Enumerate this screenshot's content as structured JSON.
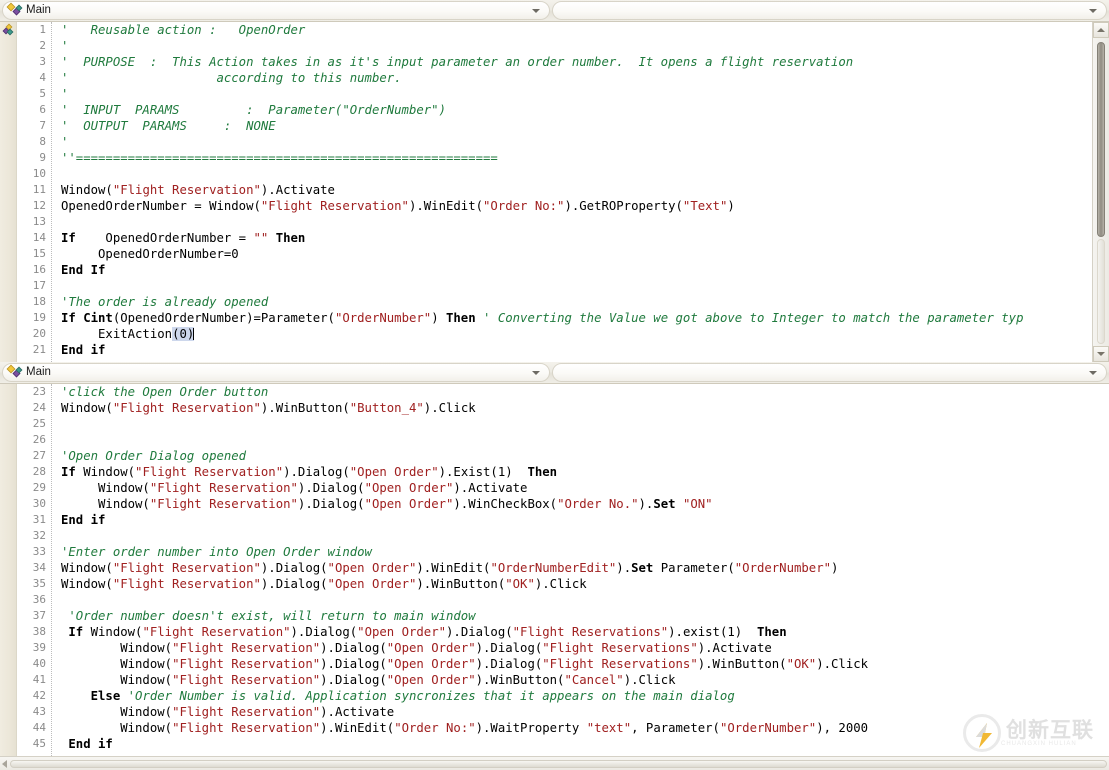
{
  "window": {
    "title": "Main",
    "app_kind": "script-editor"
  },
  "panes": [
    {
      "header": {
        "icon": "flow-action-icon",
        "label": "Main",
        "dropdown_icon": "chevron-down-icon",
        "second_combo_value": "",
        "second_dropdown_icon": "chevron-down-icon"
      },
      "gutter_icon": "flow-action-icon",
      "first_line": 1,
      "lines": [
        {
          "n": 1,
          "tokens": [
            {
              "t": "cm",
              "v": "'   Reusable action :   OpenOrder"
            }
          ]
        },
        {
          "n": 2,
          "tokens": [
            {
              "t": "cm",
              "v": "'"
            }
          ]
        },
        {
          "n": 3,
          "tokens": [
            {
              "t": "cm",
              "v": "'  PURPOSE  :  This Action takes in as it's input parameter an order number.  It opens a flight reservation"
            }
          ]
        },
        {
          "n": 4,
          "tokens": [
            {
              "t": "cm",
              "v": "'                    according to this number."
            }
          ]
        },
        {
          "n": 5,
          "tokens": [
            {
              "t": "cm",
              "v": "'"
            }
          ]
        },
        {
          "n": 6,
          "tokens": [
            {
              "t": "cm",
              "v": "'  INPUT  PARAMS         :  Parameter(\"OrderNumber\")"
            }
          ]
        },
        {
          "n": 7,
          "tokens": [
            {
              "t": "cm",
              "v": "'  OUTPUT  PARAMS     :  NONE"
            }
          ]
        },
        {
          "n": 8,
          "tokens": [
            {
              "t": "cm",
              "v": "'"
            }
          ]
        },
        {
          "n": 9,
          "tokens": [
            {
              "t": "cm",
              "v": "''========================================================="
            }
          ]
        },
        {
          "n": 10,
          "tokens": []
        },
        {
          "n": 11,
          "tokens": [
            {
              "t": "pl",
              "v": "Window("
            },
            {
              "t": "str",
              "v": "\"Flight Reservation\""
            },
            {
              "t": "pl",
              "v": ").Activate"
            }
          ]
        },
        {
          "n": 12,
          "tokens": [
            {
              "t": "pl",
              "v": "OpenedOrderNumber = Window("
            },
            {
              "t": "str",
              "v": "\"Flight Reservation\""
            },
            {
              "t": "pl",
              "v": ").WinEdit("
            },
            {
              "t": "str",
              "v": "\"Order No:\""
            },
            {
              "t": "pl",
              "v": ").GetROProperty("
            },
            {
              "t": "str",
              "v": "\"Text\""
            },
            {
              "t": "pl",
              "v": ")"
            }
          ]
        },
        {
          "n": 13,
          "tokens": []
        },
        {
          "n": 14,
          "tokens": [
            {
              "t": "kw",
              "v": "If"
            },
            {
              "t": "pl",
              "v": "    OpenedOrderNumber = "
            },
            {
              "t": "str",
              "v": "\"\""
            },
            {
              "t": "pl",
              "v": " "
            },
            {
              "t": "kw",
              "v": "Then"
            }
          ]
        },
        {
          "n": 15,
          "tokens": [
            {
              "t": "pl",
              "v": "     OpenedOrderNumber=0"
            }
          ]
        },
        {
          "n": 16,
          "tokens": [
            {
              "t": "kw",
              "v": "End If"
            }
          ]
        },
        {
          "n": 17,
          "tokens": []
        },
        {
          "n": 18,
          "tokens": [
            {
              "t": "cm",
              "v": "'The order is already opened"
            }
          ]
        },
        {
          "n": 19,
          "tokens": [
            {
              "t": "kw",
              "v": "If Cint"
            },
            {
              "t": "pl",
              "v": "(OpenedOrderNumber)=Parameter("
            },
            {
              "t": "str",
              "v": "\"OrderNumber\""
            },
            {
              "t": "pl",
              "v": ") "
            },
            {
              "t": "kw",
              "v": "Then"
            },
            {
              "t": "pl",
              "v": " "
            },
            {
              "t": "cm",
              "v": "' Converting the Value we got above to Integer to match the parameter typ"
            }
          ]
        },
        {
          "n": 20,
          "tokens": [
            {
              "t": "pl",
              "v": "     ExitAction"
            },
            {
              "t": "sel",
              "v": "(0)"
            },
            {
              "t": "caret",
              "v": ""
            }
          ]
        },
        {
          "n": 21,
          "tokens": [
            {
              "t": "kw",
              "v": "End if"
            }
          ]
        }
      ]
    },
    {
      "header": {
        "icon": "flow-action-icon",
        "label": "Main",
        "dropdown_icon": "chevron-down-icon",
        "second_combo_value": "",
        "second_dropdown_icon": "chevron-down-icon"
      },
      "gutter_icon": "flow-action-icon",
      "first_line": 23,
      "lines": [
        {
          "n": 23,
          "tokens": [
            {
              "t": "cm",
              "v": "'click the Open Order button"
            }
          ]
        },
        {
          "n": 24,
          "tokens": [
            {
              "t": "pl",
              "v": "Window("
            },
            {
              "t": "str",
              "v": "\"Flight Reservation\""
            },
            {
              "t": "pl",
              "v": ").WinButton("
            },
            {
              "t": "str",
              "v": "\"Button_4\""
            },
            {
              "t": "pl",
              "v": ").Click"
            }
          ]
        },
        {
          "n": 25,
          "tokens": []
        },
        {
          "n": 26,
          "tokens": []
        },
        {
          "n": 27,
          "tokens": [
            {
              "t": "cm",
              "v": "'Open Order Dialog opened"
            }
          ]
        },
        {
          "n": 28,
          "tokens": [
            {
              "t": "kw",
              "v": "If"
            },
            {
              "t": "pl",
              "v": " Window("
            },
            {
              "t": "str",
              "v": "\"Flight Reservation\""
            },
            {
              "t": "pl",
              "v": ").Dialog("
            },
            {
              "t": "str",
              "v": "\"Open Order\""
            },
            {
              "t": "pl",
              "v": ").Exist(1)  "
            },
            {
              "t": "kw",
              "v": "Then"
            }
          ]
        },
        {
          "n": 29,
          "tokens": [
            {
              "t": "pl",
              "v": "     Window("
            },
            {
              "t": "str",
              "v": "\"Flight Reservation\""
            },
            {
              "t": "pl",
              "v": ").Dialog("
            },
            {
              "t": "str",
              "v": "\"Open Order\""
            },
            {
              "t": "pl",
              "v": ").Activate"
            }
          ]
        },
        {
          "n": 30,
          "tokens": [
            {
              "t": "pl",
              "v": "     Window("
            },
            {
              "t": "str",
              "v": "\"Flight Reservation\""
            },
            {
              "t": "pl",
              "v": ").Dialog("
            },
            {
              "t": "str",
              "v": "\"Open Order\""
            },
            {
              "t": "pl",
              "v": ").WinCheckBox("
            },
            {
              "t": "str",
              "v": "\"Order No.\""
            },
            {
              "t": "pl",
              "v": ")."
            },
            {
              "t": "kw",
              "v": "Set"
            },
            {
              "t": "pl",
              "v": " "
            },
            {
              "t": "str",
              "v": "\"ON\""
            }
          ]
        },
        {
          "n": 31,
          "tokens": [
            {
              "t": "kw",
              "v": "End if"
            }
          ]
        },
        {
          "n": 32,
          "tokens": []
        },
        {
          "n": 33,
          "tokens": [
            {
              "t": "cm",
              "v": "'Enter order number into Open Order window"
            }
          ]
        },
        {
          "n": 34,
          "tokens": [
            {
              "t": "pl",
              "v": "Window("
            },
            {
              "t": "str",
              "v": "\"Flight Reservation\""
            },
            {
              "t": "pl",
              "v": ").Dialog("
            },
            {
              "t": "str",
              "v": "\"Open Order\""
            },
            {
              "t": "pl",
              "v": ").WinEdit("
            },
            {
              "t": "str",
              "v": "\"OrderNumberEdit\""
            },
            {
              "t": "pl",
              "v": ")."
            },
            {
              "t": "kw",
              "v": "Set"
            },
            {
              "t": "pl",
              "v": " Parameter("
            },
            {
              "t": "str",
              "v": "\"OrderNumber\""
            },
            {
              "t": "pl",
              "v": ")"
            }
          ]
        },
        {
          "n": 35,
          "tokens": [
            {
              "t": "pl",
              "v": "Window("
            },
            {
              "t": "str",
              "v": "\"Flight Reservation\""
            },
            {
              "t": "pl",
              "v": ").Dialog("
            },
            {
              "t": "str",
              "v": "\"Open Order\""
            },
            {
              "t": "pl",
              "v": ").WinButton("
            },
            {
              "t": "str",
              "v": "\"OK\""
            },
            {
              "t": "pl",
              "v": ").Click"
            }
          ]
        },
        {
          "n": 36,
          "tokens": []
        },
        {
          "n": 37,
          "tokens": [
            {
              "t": "cm",
              "v": " 'Order number doesn't exist, will return to main window"
            }
          ]
        },
        {
          "n": 38,
          "tokens": [
            {
              "t": "pl",
              "v": " "
            },
            {
              "t": "kw",
              "v": "If"
            },
            {
              "t": "pl",
              "v": " Window("
            },
            {
              "t": "str",
              "v": "\"Flight Reservation\""
            },
            {
              "t": "pl",
              "v": ").Dialog("
            },
            {
              "t": "str",
              "v": "\"Open Order\""
            },
            {
              "t": "pl",
              "v": ").Dialog("
            },
            {
              "t": "str",
              "v": "\"Flight Reservations\""
            },
            {
              "t": "pl",
              "v": ").exist(1)  "
            },
            {
              "t": "kw",
              "v": "Then"
            }
          ]
        },
        {
          "n": 39,
          "tokens": [
            {
              "t": "pl",
              "v": "        Window("
            },
            {
              "t": "str",
              "v": "\"Flight Reservation\""
            },
            {
              "t": "pl",
              "v": ").Dialog("
            },
            {
              "t": "str",
              "v": "\"Open Order\""
            },
            {
              "t": "pl",
              "v": ").Dialog("
            },
            {
              "t": "str",
              "v": "\"Flight Reservations\""
            },
            {
              "t": "pl",
              "v": ").Activate"
            }
          ]
        },
        {
          "n": 40,
          "tokens": [
            {
              "t": "pl",
              "v": "        Window("
            },
            {
              "t": "str",
              "v": "\"Flight Reservation\""
            },
            {
              "t": "pl",
              "v": ").Dialog("
            },
            {
              "t": "str",
              "v": "\"Open Order\""
            },
            {
              "t": "pl",
              "v": ").Dialog("
            },
            {
              "t": "str",
              "v": "\"Flight Reservations\""
            },
            {
              "t": "pl",
              "v": ").WinButton("
            },
            {
              "t": "str",
              "v": "\"OK\""
            },
            {
              "t": "pl",
              "v": ").Click"
            }
          ]
        },
        {
          "n": 41,
          "tokens": [
            {
              "t": "pl",
              "v": "        Window("
            },
            {
              "t": "str",
              "v": "\"Flight Reservation\""
            },
            {
              "t": "pl",
              "v": ").Dialog("
            },
            {
              "t": "str",
              "v": "\"Open Order\""
            },
            {
              "t": "pl",
              "v": ").WinButton("
            },
            {
              "t": "str",
              "v": "\"Cancel\""
            },
            {
              "t": "pl",
              "v": ").Click"
            }
          ]
        },
        {
          "n": 42,
          "tokens": [
            {
              "t": "pl",
              "v": "    "
            },
            {
              "t": "kw",
              "v": "Else"
            },
            {
              "t": "pl",
              "v": " "
            },
            {
              "t": "cm",
              "v": "'Order Number is valid. Application syncronizes that it appears on the main dialog"
            }
          ]
        },
        {
          "n": 43,
          "tokens": [
            {
              "t": "pl",
              "v": "        Window("
            },
            {
              "t": "str",
              "v": "\"Flight Reservation\""
            },
            {
              "t": "pl",
              "v": ").Activate"
            }
          ]
        },
        {
          "n": 44,
          "tokens": [
            {
              "t": "pl",
              "v": "        Window("
            },
            {
              "t": "str",
              "v": "\"Flight Reservation\""
            },
            {
              "t": "pl",
              "v": ").WinEdit("
            },
            {
              "t": "str",
              "v": "\"Order No:\""
            },
            {
              "t": "pl",
              "v": ").WaitProperty "
            },
            {
              "t": "str",
              "v": "\"text\""
            },
            {
              "t": "pl",
              "v": ", Parameter("
            },
            {
              "t": "str",
              "v": "\"OrderNumber\""
            },
            {
              "t": "pl",
              "v": "), 2000"
            }
          ]
        },
        {
          "n": 45,
          "tokens": [
            {
              "t": "pl",
              "v": " "
            },
            {
              "t": "kw",
              "v": "End if"
            }
          ]
        }
      ]
    }
  ],
  "scrollbars": {
    "vertical_top": {
      "up_icon": "scroll-up-arrow-icon",
      "down_icon": "scroll-down-arrow-icon"
    },
    "horizontal_bottom": {
      "left_icon": "scroll-left-arrow-icon"
    }
  },
  "watermark": {
    "text": "创新互联",
    "logo_icon": "lightning-circle-logo-icon"
  },
  "colors": {
    "comment": "#1f7a3d",
    "string": "#a02020",
    "keyword": "#000000",
    "plain": "#000000",
    "selection": "#cdd7ec",
    "gutter": "#ece7d9",
    "chrome": "#ece9e1"
  }
}
